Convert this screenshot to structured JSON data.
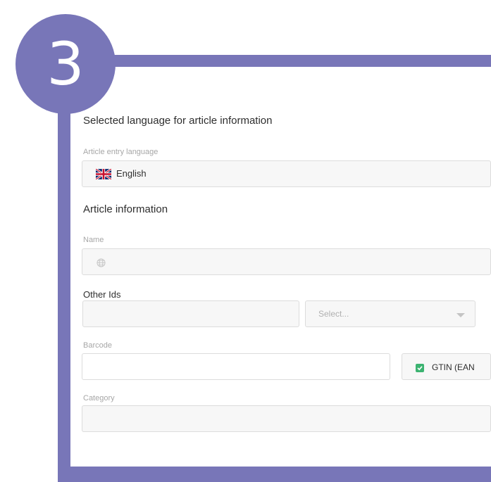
{
  "badge": {
    "number": "3"
  },
  "language_section": {
    "title": "Selected language for article information",
    "entry_label": "Article entry language",
    "selected_language": "English",
    "flag_icon": "uk-flag-icon"
  },
  "article_section": {
    "title": "Article information",
    "name_label": "Name",
    "name_value": "",
    "other_ids_label": "Other Ids",
    "other_ids_value": "",
    "other_ids_select_placeholder": "Select...",
    "barcode_label": "Barcode",
    "barcode_value": "",
    "gtin_label": "GTIN (EAN",
    "gtin_checked": true,
    "category_label": "Category",
    "category_value": ""
  },
  "colors": {
    "frame": "#7876b8",
    "checkbox": "#3cb371"
  }
}
